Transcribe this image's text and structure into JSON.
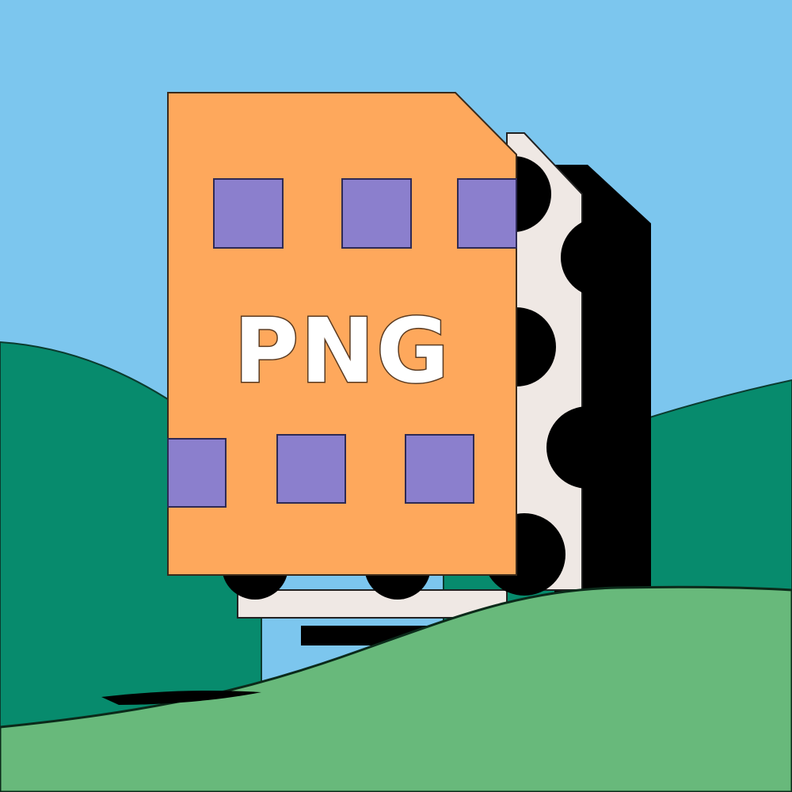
{
  "file_icon": {
    "label": "PNG"
  },
  "colors": {
    "sky": "#7cc6ee",
    "back_hill": "#078b6d",
    "front_hill": "#68b97b",
    "file_body": "#fea85c",
    "file_squares": "#8b7fcd",
    "film_strip": "#efe8e4",
    "shadow": "#000000",
    "label_text": "#ffffff"
  }
}
